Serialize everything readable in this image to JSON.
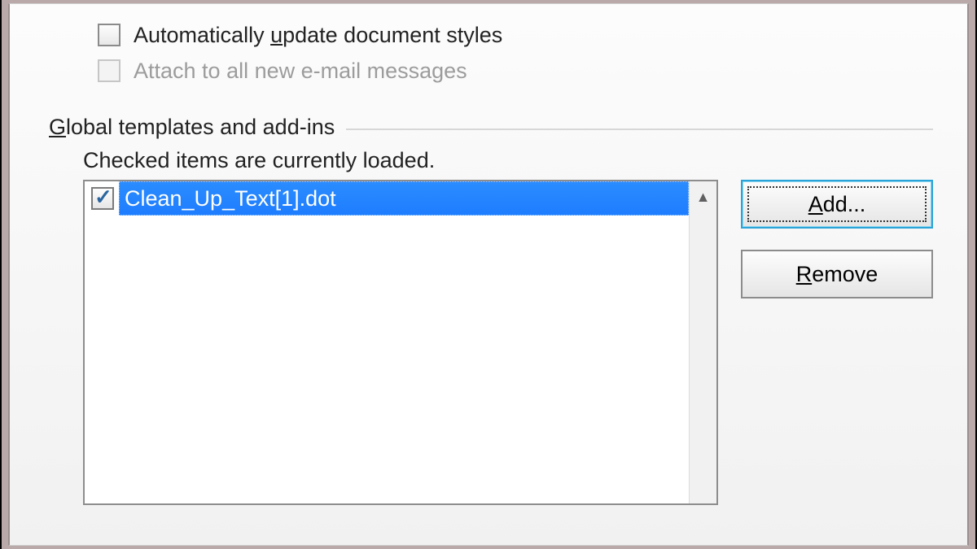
{
  "checkboxes": {
    "auto_update": {
      "label_pre": "Automatically ",
      "accel": "u",
      "label_post": "pdate document styles",
      "checked": false,
      "enabled": true
    },
    "attach_email": {
      "label": "Attach to all new e-mail messages",
      "checked": false,
      "enabled": false
    }
  },
  "section": {
    "title_accel": "G",
    "title_rest": "lobal templates and add-ins"
  },
  "subtext": "Checked items are currently loaded.",
  "list": {
    "items": [
      {
        "label": "Clean_Up_Text[1].dot",
        "checked": true,
        "selected": true
      }
    ]
  },
  "buttons": {
    "add_accel": "A",
    "add_rest": "dd...",
    "remove_accel": "R",
    "remove_rest": "emove"
  }
}
